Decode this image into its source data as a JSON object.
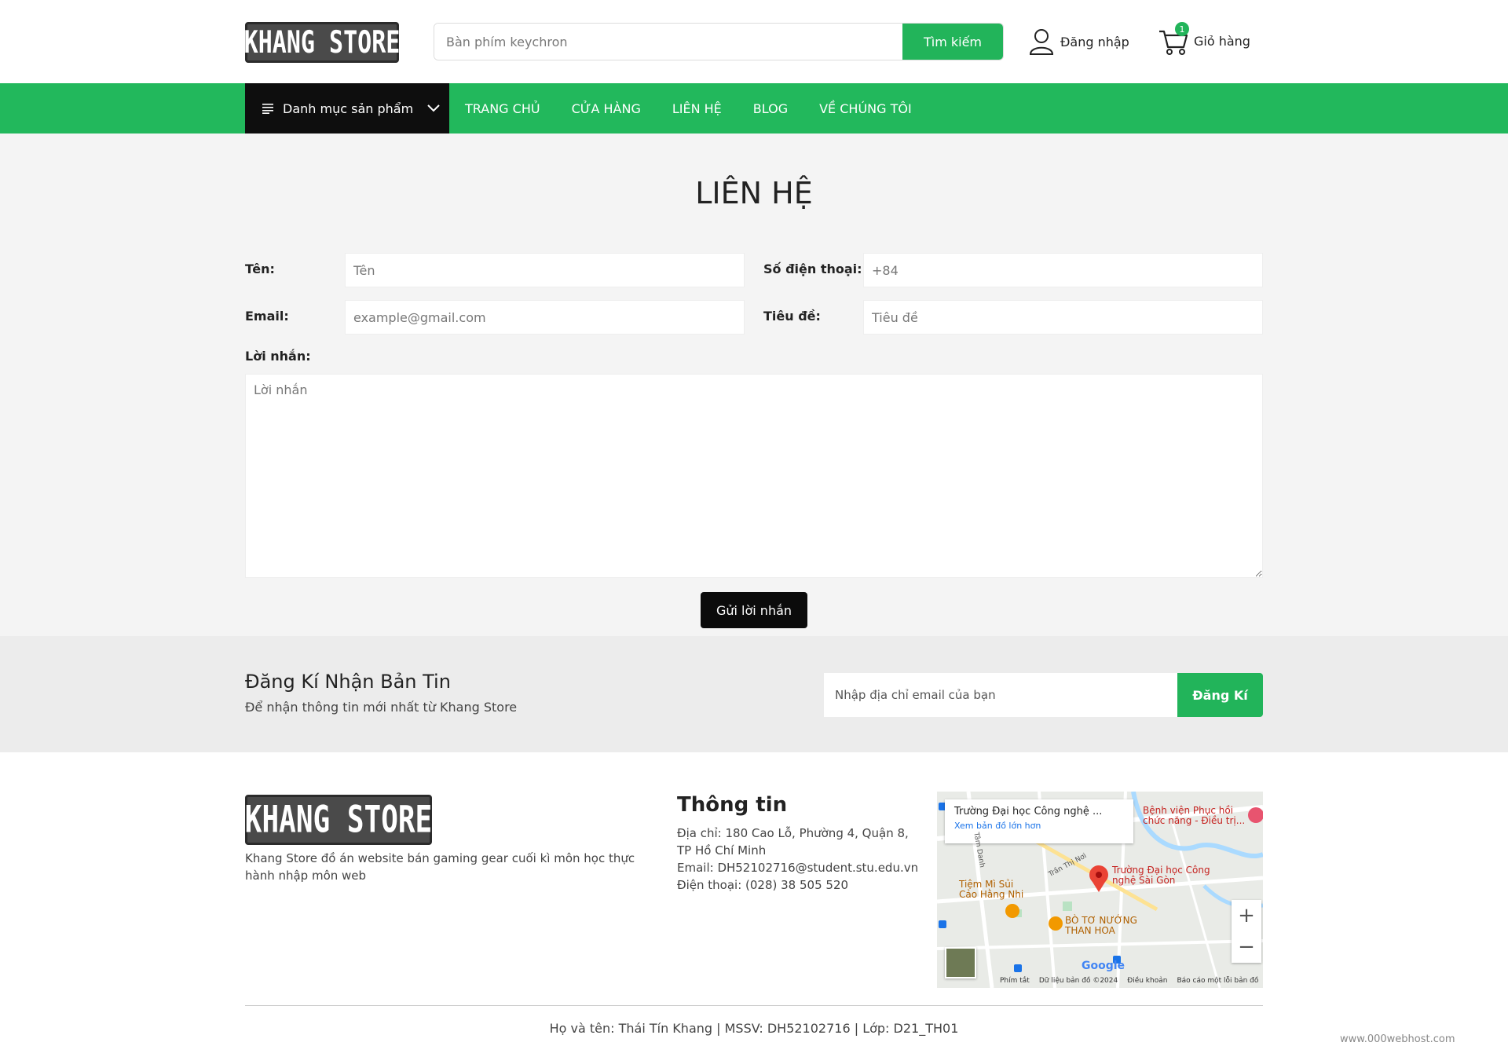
{
  "header": {
    "logo": "KHANG STORE",
    "search_placeholder": "Bàn phím keychron",
    "search_button": "Tìm kiếm",
    "login": "Đăng nhập",
    "cart": "Giỏ hàng",
    "cart_count": "1"
  },
  "nav": {
    "category_button": "Danh mục sản phẩm",
    "links": [
      "TRANG CHỦ",
      "CỬA HÀNG",
      "LIÊN HỆ",
      "BLOG",
      "VỀ CHÚNG TÔI"
    ]
  },
  "contact": {
    "title": "LIÊN HỆ",
    "name_label": "Tên:",
    "name_placeholder": "Tên",
    "phone_label": "Số điện thoại:",
    "phone_placeholder": "+84",
    "email_label": "Email:",
    "email_placeholder": "example@gmail.com",
    "subject_label": "Tiêu đề:",
    "subject_placeholder": "Tiêu đề",
    "message_label": "Lời nhắn:",
    "message_placeholder": "Lời nhắn",
    "send_button": "Gửi lời nhắn"
  },
  "newsletter": {
    "title": "Đăng Kí Nhận Bản Tin",
    "subtitle": "Để nhận thông tin mới nhất từ Khang Store",
    "input_placeholder": "Nhập địa chỉ email của bạn",
    "button": "Đăng Kí"
  },
  "footer": {
    "logo": "KHANG STORE",
    "description": "Khang Store đồ án website bán gaming gear cuối kì môn học thực hành nhập môn web",
    "info_title": "Thông tin",
    "address": "Địa chỉ: 180 Cao Lỗ, Phường 4, Quận 8, TP Hồ Chí Minh",
    "email": "Email: DH52102716@student.stu.edu.vn",
    "phone": "Điện thoại: (028) 38 505 520",
    "credit": "Họ và tên: Thái Tín Khang | MSSV: DH52102716 | Lớp: D21_TH01",
    "host": "www.000webhost.com"
  },
  "map": {
    "card_title": "Trường Đại học Công nghệ ...",
    "card_link": "Xem bản đồ lớn hơn",
    "place_main": "Trường Đại học Công nghệ Sài Gòn",
    "place_hospital": "Bệnh viện Phục hồi chức năng - Điều trị...",
    "place_tiem": "Tiệm Mì Sủi Cảo Hằng Nhi",
    "place_bo": "BÒ TƠ NƯỚNG THAN HOA",
    "street_tran": "Trần Thị Nơi",
    "street_tam": "Tâm Danh",
    "google": "Google",
    "zoom_in": "+",
    "zoom_out": "−",
    "foot_shortcuts": "Phím tắt",
    "foot_data": "Dữ liệu bản đồ ©2024",
    "foot_terms": "Điều khoản",
    "foot_report": "Báo cáo một lỗi bản đồ"
  },
  "colors": {
    "accent": "#22b45a",
    "dark": "#0e0e0e"
  }
}
